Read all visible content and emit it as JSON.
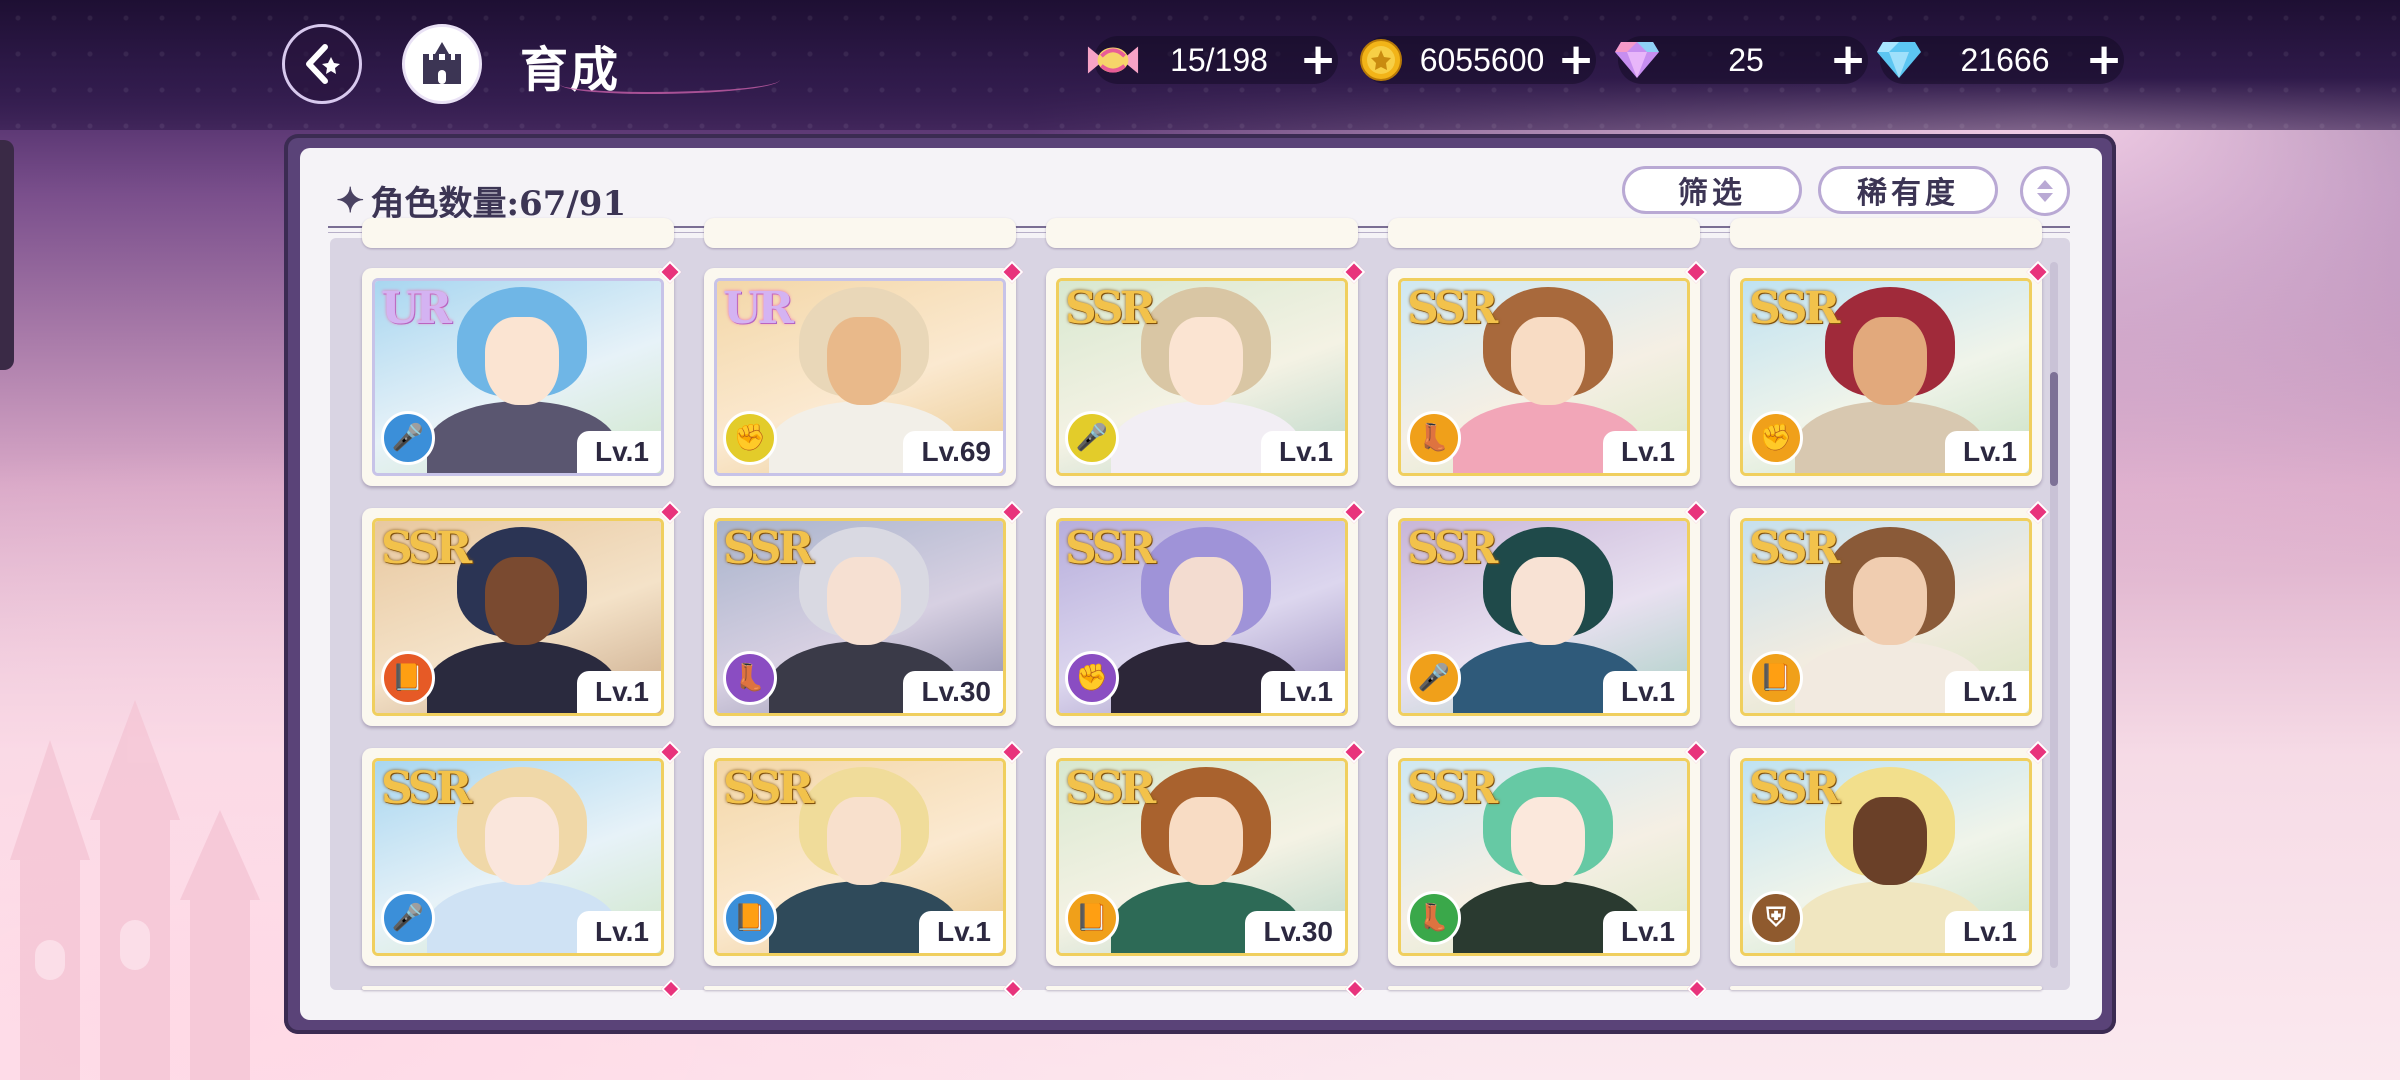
{
  "header": {
    "title": "育成",
    "back_icon": "back-arrow-icon",
    "home_icon": "castle-icon"
  },
  "resources": [
    {
      "name": "stamina",
      "icon": "candy-icon",
      "value": "15/198"
    },
    {
      "name": "gold",
      "icon": "coin-icon",
      "value": "6055600"
    },
    {
      "name": "paid-gem",
      "icon": "rainbow-gem-icon",
      "value": "25"
    },
    {
      "name": "free-gem",
      "icon": "blue-gem-icon",
      "value": "21666"
    }
  ],
  "panel": {
    "count_label": "角色数量:67/91",
    "filter_label": "筛选",
    "sort_label": "稀有度"
  },
  "colors": {
    "ssr_gold": "#f2c24b",
    "ur_lilac": "#d4b3f2",
    "new_gem": "#e8337c",
    "panel_frame": "#5a4378"
  },
  "cards": [
    {
      "rarity": "UR",
      "level": "Lv.1",
      "attr_icon": "microphone-icon",
      "attr_color": "#3b8fd9"
    },
    {
      "rarity": "UR",
      "level": "Lv.69",
      "attr_icon": "fist-icon",
      "attr_color": "#e3cc2a"
    },
    {
      "rarity": "SSR",
      "level": "Lv.1",
      "attr_icon": "microphone-icon",
      "attr_color": "#e3cc2a"
    },
    {
      "rarity": "SSR",
      "level": "Lv.1",
      "attr_icon": "boot-icon",
      "attr_color": "#f0a01a"
    },
    {
      "rarity": "SSR",
      "level": "Lv.1",
      "attr_icon": "fist-icon",
      "attr_color": "#f0a01a"
    },
    {
      "rarity": "SSR",
      "level": "Lv.1",
      "attr_icon": "book-icon",
      "attr_color": "#e65a26"
    },
    {
      "rarity": "SSR",
      "level": "Lv.30",
      "attr_icon": "boot-icon",
      "attr_color": "#8a4dc2"
    },
    {
      "rarity": "SSR",
      "level": "Lv.1",
      "attr_icon": "fist-icon",
      "attr_color": "#8a4dc2"
    },
    {
      "rarity": "SSR",
      "level": "Lv.1",
      "attr_icon": "microphone-icon",
      "attr_color": "#f0a01a"
    },
    {
      "rarity": "SSR",
      "level": "Lv.1",
      "attr_icon": "book-icon",
      "attr_color": "#f0a01a"
    },
    {
      "rarity": "SSR",
      "level": "Lv.1",
      "attr_icon": "microphone-icon",
      "attr_color": "#3b8fd9"
    },
    {
      "rarity": "SSR",
      "level": "Lv.1",
      "attr_icon": "book-icon",
      "attr_color": "#3b8fd9"
    },
    {
      "rarity": "SSR",
      "level": "Lv.30",
      "attr_icon": "book-icon",
      "attr_color": "#f0a01a"
    },
    {
      "rarity": "SSR",
      "level": "Lv.1",
      "attr_icon": "boot-icon",
      "attr_color": "#3aa84a"
    },
    {
      "rarity": "SSR",
      "level": "Lv.1",
      "attr_icon": "shield-icon",
      "attr_color": "#8f5a2e"
    }
  ]
}
